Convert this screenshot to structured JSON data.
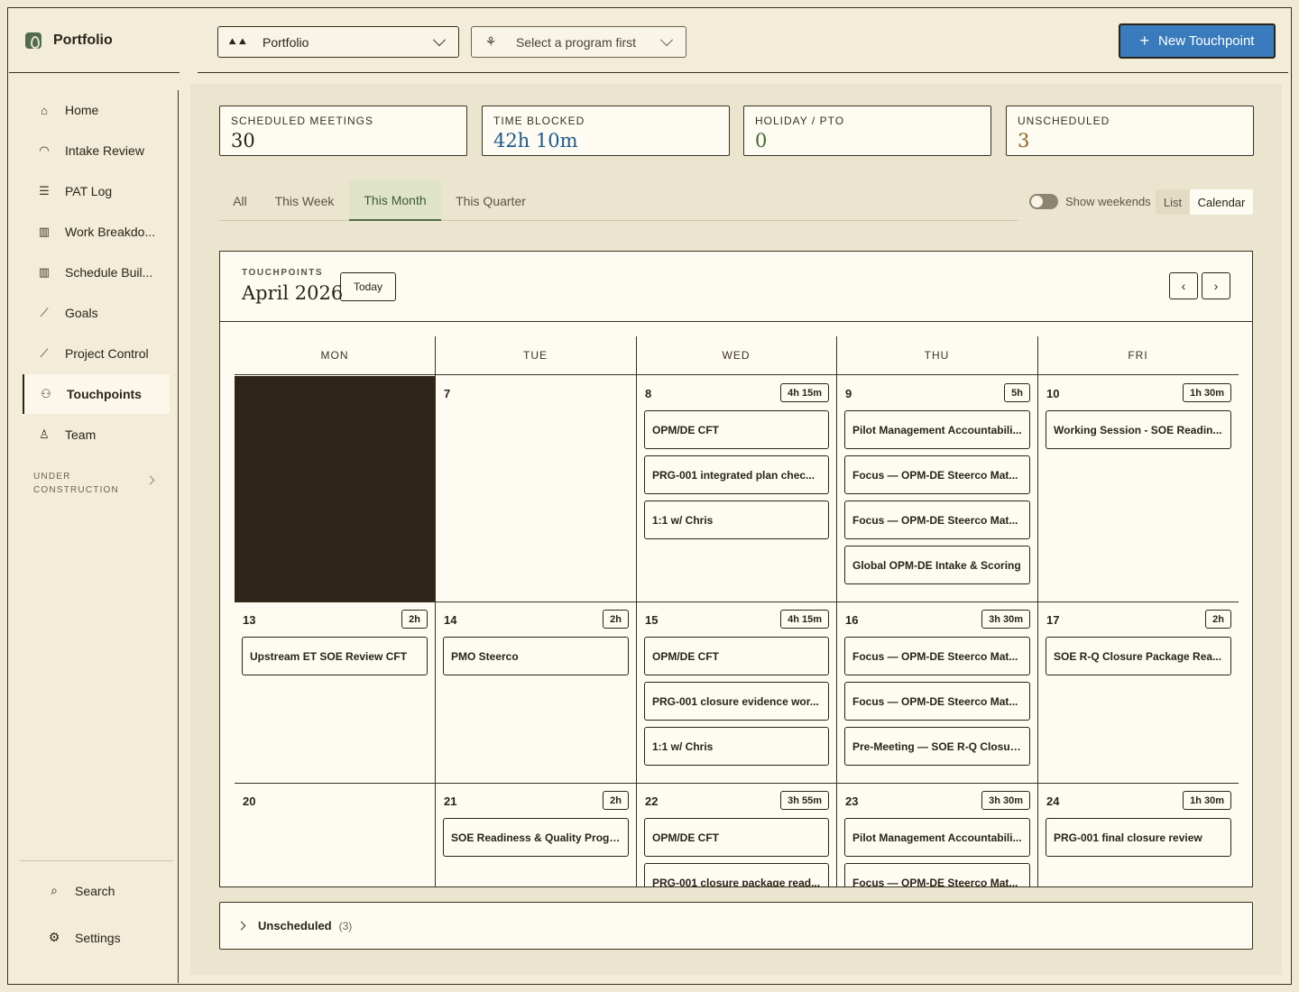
{
  "app": {
    "name": "Portfolio"
  },
  "header": {
    "program_select": {
      "icon": "trees-icon",
      "value": "Portfolio"
    },
    "sub_select": {
      "icon": "plant-icon",
      "value": "Select a program first"
    },
    "new_button": "New Touchpoint"
  },
  "sidebar": {
    "items": [
      {
        "label": "Home",
        "icon": "home-icon",
        "glyph": "⌂"
      },
      {
        "label": "Intake Review",
        "icon": "gauge-icon",
        "glyph": "◠"
      },
      {
        "label": "PAT Log",
        "icon": "list-icon",
        "glyph": "☰"
      },
      {
        "label": "Work Breakdo...",
        "icon": "columns-icon",
        "glyph": "▥"
      },
      {
        "label": "Schedule Buil...",
        "icon": "columns-icon",
        "glyph": "▥"
      },
      {
        "label": "Goals",
        "icon": "chart-icon",
        "glyph": "⟋"
      },
      {
        "label": "Project Control",
        "icon": "chart-icon",
        "glyph": "⟋"
      },
      {
        "label": "Touchpoints",
        "icon": "users-icon",
        "glyph": "⚇"
      },
      {
        "label": "Team",
        "icon": "user-icon",
        "glyph": "♙"
      }
    ],
    "section_label_1": "UNDER",
    "section_label_2": "CONSTRUCTION",
    "search": "Search",
    "settings": "Settings"
  },
  "stats": [
    {
      "label": "SCHEDULED MEETINGS",
      "value": "30",
      "color": "#2a2419"
    },
    {
      "label": "TIME BLOCKED",
      "value": "42h 10m",
      "color": "#1f5a8a"
    },
    {
      "label": "HOLIDAY / PTO",
      "value": "0",
      "color": "#3d6b2f"
    },
    {
      "label": "UNSCHEDULED",
      "value": "3",
      "color": "#8a6a1a"
    }
  ],
  "tabs": [
    "All",
    "This Week",
    "This Month",
    "This Quarter"
  ],
  "active_tab": "This Month",
  "weekends_label": "Show weekends",
  "view": {
    "list": "List",
    "calendar": "Calendar",
    "selected": "Calendar"
  },
  "calendar": {
    "kicker": "TOUCHPOINTS",
    "title": "April 2026",
    "today": "Today",
    "prev": "‹",
    "next": "›",
    "days_of_week": [
      "MON",
      "TUE",
      "WED",
      "THU",
      "FRI"
    ],
    "weeks": [
      [
        {
          "blocked": true
        },
        {
          "day": "7"
        },
        {
          "day": "8",
          "duration": "4h 15m",
          "events": [
            "OPM/DE CFT",
            "PRG-001 integrated plan chec...",
            "1:1 w/ Chris"
          ]
        },
        {
          "day": "9",
          "duration": "5h",
          "events": [
            "Pilot Management Accountabili...",
            "Focus — OPM-DE Steerco Mat...",
            "Focus — OPM-DE Steerco Mat...",
            "Global OPM-DE Intake & Scoring"
          ]
        },
        {
          "day": "10",
          "duration": "1h 30m",
          "events": [
            "Working Session - SOE Readin..."
          ]
        }
      ],
      [
        {
          "day": "13",
          "duration": "2h",
          "events": [
            "Upstream ET SOE Review CFT"
          ]
        },
        {
          "day": "14",
          "duration": "2h",
          "events": [
            "PMO Steerco"
          ]
        },
        {
          "day": "15",
          "duration": "4h 15m",
          "events": [
            "OPM/DE CFT",
            "PRG-001 closure evidence wor...",
            "1:1 w/ Chris"
          ]
        },
        {
          "day": "16",
          "duration": "3h 30m",
          "events": [
            "Focus — OPM-DE Steerco Mat...",
            "Focus — OPM-DE Steerco Mat...",
            "Pre-Meeting — SOE R-Q Closur..."
          ]
        },
        {
          "day": "17",
          "duration": "2h",
          "events": [
            "SOE R-Q Closure Package Rea..."
          ]
        }
      ],
      [
        {
          "day": "20"
        },
        {
          "day": "21",
          "duration": "2h",
          "events": [
            "SOE Readiness & Quality Progr..."
          ]
        },
        {
          "day": "22",
          "duration": "3h 55m",
          "events": [
            "OPM/DE CFT",
            "PRG-001 closure package read..."
          ]
        },
        {
          "day": "23",
          "duration": "3h 30m",
          "events": [
            "Pilot Management Accountabili...",
            "Focus — OPM-DE Steerco Mat..."
          ]
        },
        {
          "day": "24",
          "duration": "1h 30m",
          "events": [
            "PRG-001 final closure review"
          ]
        }
      ]
    ]
  },
  "unscheduled": {
    "label": "Unscheduled",
    "count": "(3)"
  }
}
